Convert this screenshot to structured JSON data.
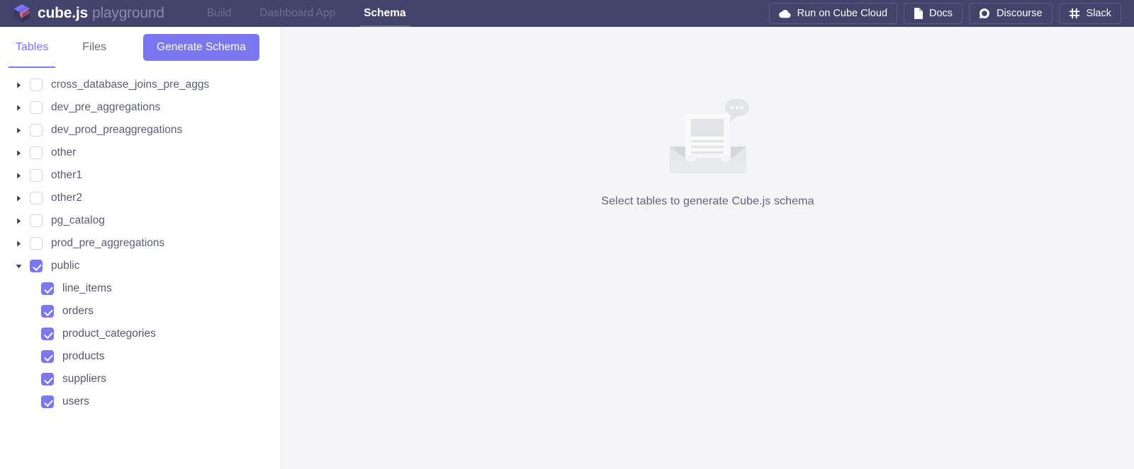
{
  "header": {
    "brand": {
      "name": "cube.js",
      "suffix": "playground",
      "logo_icon": "cube-logo-icon"
    },
    "nav": [
      {
        "label": "Build",
        "active": false
      },
      {
        "label": "Dashboard App",
        "active": false
      },
      {
        "label": "Schema",
        "active": true
      }
    ],
    "actions": [
      {
        "label": "Run on Cube Cloud",
        "icon": "cloud-icon"
      },
      {
        "label": "Docs",
        "icon": "document-icon"
      },
      {
        "label": "Discourse",
        "icon": "discourse-icon"
      },
      {
        "label": "Slack",
        "icon": "slack-icon"
      }
    ],
    "colors": {
      "background": "#43436b",
      "active_text": "#ffffff",
      "inactive_text": "#6e6d92"
    }
  },
  "sidebar": {
    "tabs": [
      {
        "label": "Tables",
        "active": true
      },
      {
        "label": "Files",
        "active": false
      }
    ],
    "generate_button": "Generate Schema",
    "tree": [
      {
        "label": "cross_database_joins_pre_aggs",
        "checked": false,
        "expanded": false,
        "level": 0
      },
      {
        "label": "dev_pre_aggregations",
        "checked": false,
        "expanded": false,
        "level": 0
      },
      {
        "label": "dev_prod_preaggregations",
        "checked": false,
        "expanded": false,
        "level": 0
      },
      {
        "label": "other",
        "checked": false,
        "expanded": false,
        "level": 0
      },
      {
        "label": "other1",
        "checked": false,
        "expanded": false,
        "level": 0
      },
      {
        "label": "other2",
        "checked": false,
        "expanded": false,
        "level": 0
      },
      {
        "label": "pg_catalog",
        "checked": false,
        "expanded": false,
        "level": 0
      },
      {
        "label": "prod_pre_aggregations",
        "checked": false,
        "expanded": false,
        "level": 0
      },
      {
        "label": "public",
        "checked": true,
        "expanded": true,
        "level": 0
      },
      {
        "label": "line_items",
        "checked": true,
        "expanded": null,
        "level": 1
      },
      {
        "label": "orders",
        "checked": true,
        "expanded": null,
        "level": 1
      },
      {
        "label": "product_categories",
        "checked": true,
        "expanded": null,
        "level": 1
      },
      {
        "label": "products",
        "checked": true,
        "expanded": null,
        "level": 1
      },
      {
        "label": "suppliers",
        "checked": true,
        "expanded": null,
        "level": 1
      },
      {
        "label": "users",
        "checked": true,
        "expanded": null,
        "level": 1
      }
    ],
    "colors": {
      "accent": "#7a77f0",
      "background": "#ffffff",
      "label": "#5c5c73"
    }
  },
  "main": {
    "empty_state": {
      "illustration_icon": "empty-inbox-icon",
      "text": "Select tables to generate Cube.js schema"
    },
    "colors": {
      "background": "#f5f5f7",
      "text": "#62627a"
    }
  }
}
